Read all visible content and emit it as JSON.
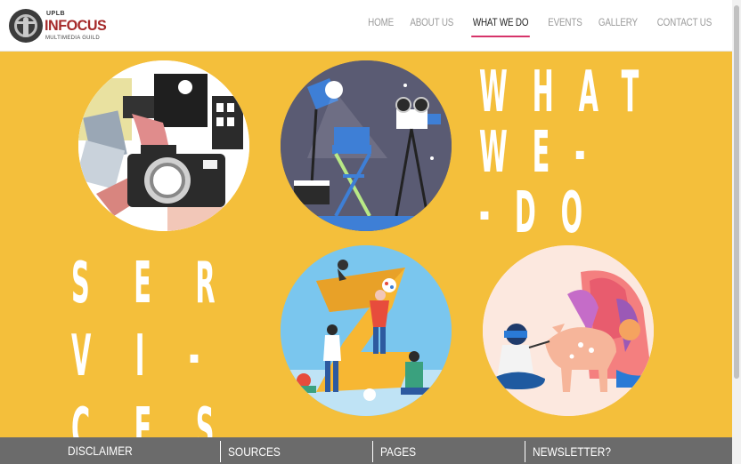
{
  "brand": {
    "top": "UPLB",
    "name": "INFOCUS",
    "sub": "MULTIMEDIA GUILD"
  },
  "nav": [
    "HOME",
    "ABOUT US",
    "WHAT WE DO",
    "EVENTS",
    "GALLERY",
    "CONTACT US"
  ],
  "nav_active": "WHAT WE DO",
  "headline_right": "W H A T W E - - D O",
  "headline_left": "S E R V I - C E S",
  "footer": [
    "DISCLAIMER",
    "SOURCES",
    "PAGES",
    "NEWSLETTER?"
  ],
  "colors": {
    "accent": "#d6346a",
    "background": "#f4bf3b",
    "footer": "#6b6b6b"
  },
  "illustrations": [
    "photography-camera",
    "film-production-clapboard",
    "graphic-design-painting",
    "illustration-artist-drawing"
  ]
}
